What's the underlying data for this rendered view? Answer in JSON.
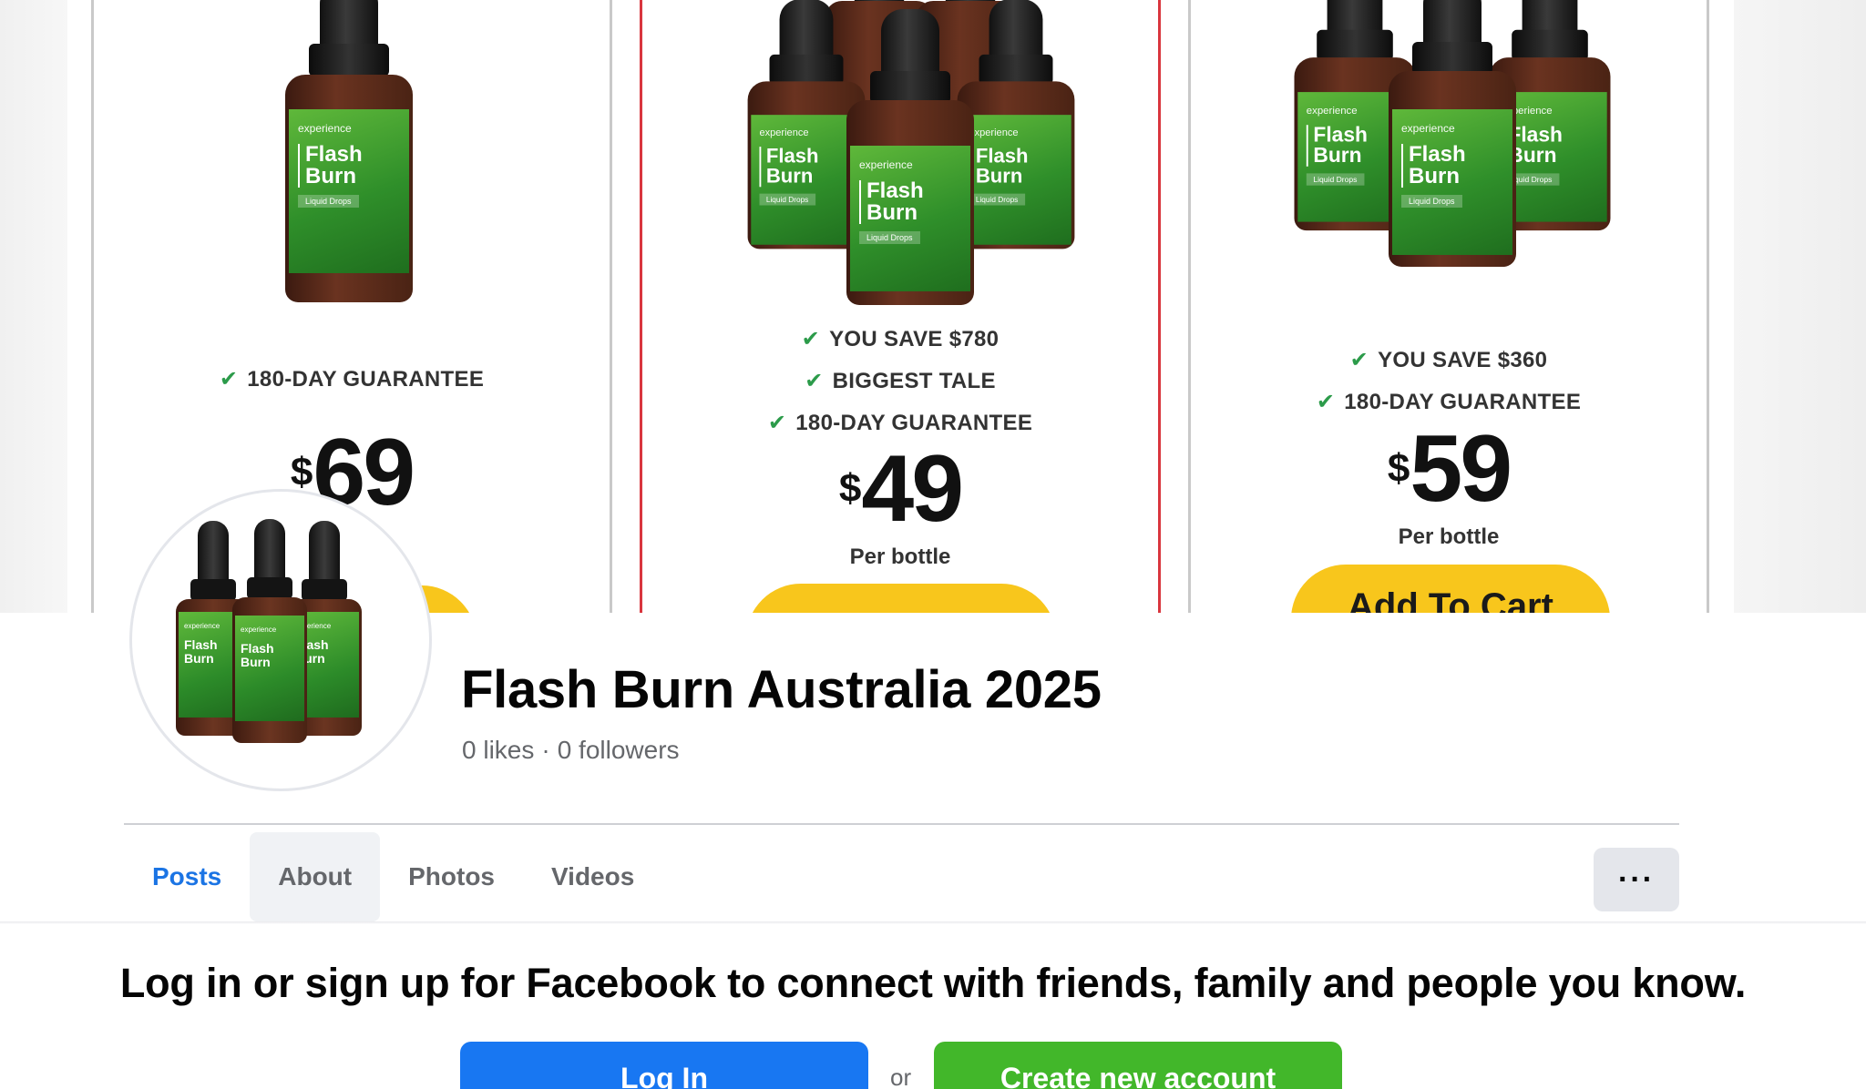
{
  "cover": {
    "offers": [
      {
        "features": [
          "180-DAY GUARANTEE"
        ],
        "currency": "$",
        "price": "69",
        "per": "",
        "cta": ""
      },
      {
        "features": [
          "YOU SAVE $780",
          "BIGGEST TALE",
          "180-DAY GUARANTEE"
        ],
        "currency": "$",
        "price": "49",
        "per": "Per bottle",
        "cta": ""
      },
      {
        "features": [
          "YOU SAVE $360",
          "180-DAY GUARANTEE"
        ],
        "currency": "$",
        "price": "59",
        "per": "Per bottle",
        "cta": "Add To Cart"
      }
    ],
    "bottle_label": {
      "brand": "experience",
      "name_line1": "Flash",
      "name_line2": "Burn",
      "sub": "Liquid Drops"
    }
  },
  "profile": {
    "name": "Flash Burn Australia 2025",
    "likes": "0 likes",
    "separator": "·",
    "followers": "0 followers"
  },
  "tabs": [
    "Posts",
    "About",
    "Photos",
    "Videos"
  ],
  "more_label": "···",
  "login_prompt": {
    "message": "Log in or sign up for Facebook to connect with friends, family and people you know.",
    "login_label": "Log In",
    "or_label": "or",
    "signup_label": "Create new account"
  },
  "colors": {
    "facebook_blue": "#1877f2",
    "signup_green": "#42b72a",
    "active_tab": "#1b74e4",
    "cta_yellow": "#f8c61c",
    "check_green": "#2c9b4a",
    "featured_border": "#d9363e"
  },
  "icons": {
    "check": "checkmark-icon",
    "more": "more-horizontal-icon"
  }
}
